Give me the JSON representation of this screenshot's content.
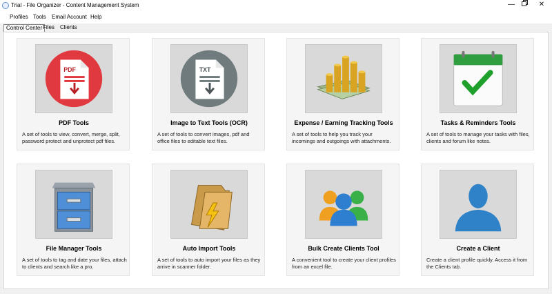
{
  "window": {
    "title": "Trial - File Organizer - Content Management System",
    "minimize": "—",
    "close": "✕"
  },
  "menu": [
    "Profiles",
    "Tools",
    "Email Account",
    "Help"
  ],
  "tabs": [
    "Control Center",
    "Files",
    "Clients"
  ],
  "cards": [
    {
      "title": "PDF Tools",
      "desc": "A set of tools to view, convert, merge, split, password protect and unprotect pdf files.",
      "icon_text": "PDF"
    },
    {
      "title": "Image to Text Tools (OCR)",
      "desc": "A set of tools to convert images, pdf and office files to editable text files.",
      "icon_text": "TXT"
    },
    {
      "title": "Expense / Earning Tracking Tools",
      "desc": "A set of tools to help you track your incomings and outgoings with attachments."
    },
    {
      "title": "Tasks & Reminders Tools",
      "desc": "A set of tools to manage your tasks with files, clients and forum like notes."
    },
    {
      "title": "File Manager Tools",
      "desc": "A set of tools to tag and date your files, attach to clients and search like a pro."
    },
    {
      "title": "Auto Import Tools",
      "desc": "A set of tools to auto import your files as they arrive in scanner folder."
    },
    {
      "title": "Bulk Create Clients Tool",
      "desc": "A convenient tool to create your client profiles from an excel file."
    },
    {
      "title": "Create a Client",
      "desc": "Create a client profile quickly. Access it from the Clients tab."
    }
  ]
}
